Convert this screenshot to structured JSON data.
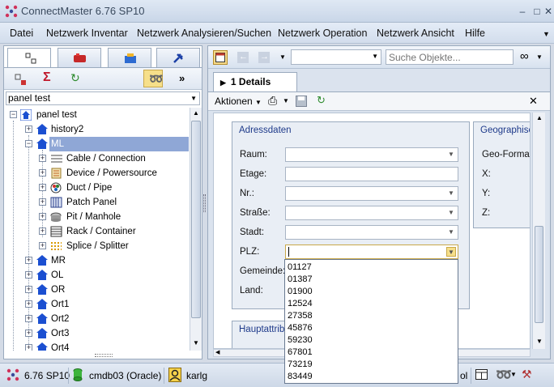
{
  "app": {
    "title": "ConnectMaster 6.76 SP10"
  },
  "menu": [
    "Datei",
    "Netzwerk Inventar",
    "Netzwerk Analysieren/Suchen",
    "Netzwerk Operation",
    "Netzwerk Ansicht",
    "Hilfe"
  ],
  "left": {
    "filter_value": "panel test",
    "tree": {
      "root": "panel test",
      "items": [
        "history2",
        "ML",
        "Cable / Connection",
        "Device / Powersource",
        "Duct / Pipe",
        "Patch Panel",
        "Pit / Manhole",
        "Rack / Container",
        "Splice / Splitter",
        "MR",
        "OL",
        "OR",
        "Ort1",
        "Ort2",
        "Ort3",
        "Ort4"
      ]
    }
  },
  "right": {
    "search_placeholder": "Suche Objekte...",
    "tab_label": "1 Details",
    "actions_label": "Aktionen",
    "groups": {
      "address": "Adressdaten",
      "geo": "Geographisch",
      "main_attrs": "Hauptattrib"
    },
    "fields": [
      "Raum:",
      "Etage:",
      "Nr.:",
      "Straße:",
      "Stadt:",
      "PLZ:",
      "Gemeinde:",
      "Land:"
    ],
    "geo_fields": [
      "Geo-Format:",
      "X:",
      "Y:",
      "Z:"
    ],
    "plz_options": [
      "01127",
      "01387",
      "01900",
      "12524",
      "27358",
      "45876",
      "59230",
      "67801",
      "73219",
      "83449"
    ]
  },
  "status": {
    "version": "6.76 SP10",
    "database": "cmdb03 (Oracle)",
    "user": "karlg",
    "extra": "ol"
  },
  "colors": {
    "accent": "#1b4fd1",
    "selection": "#8fa7d6",
    "group_title": "#1e3a8a"
  }
}
